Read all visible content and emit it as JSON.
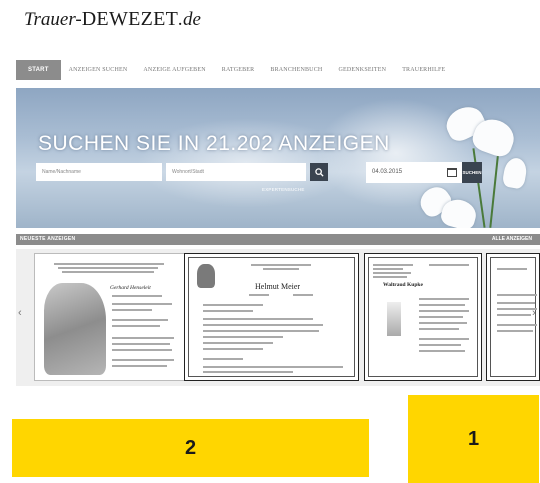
{
  "logo": {
    "part1": "Trauer-",
    "part2": "DEWEZET",
    "part3": ".de"
  },
  "nav": {
    "items": [
      {
        "label": "Start",
        "active": true
      },
      {
        "label": "Anzeigen suchen",
        "active": false
      },
      {
        "label": "Anzeige aufgeben",
        "active": false
      },
      {
        "label": "Ratgeber",
        "active": false
      },
      {
        "label": "Branchenbuch",
        "active": false
      },
      {
        "label": "Gedenkseiten",
        "active": false
      },
      {
        "label": "Trauerhilfe",
        "active": false
      }
    ]
  },
  "hero": {
    "title": "SUCHEN SIE IN 21.202 ANZEIGEN",
    "name_placeholder": "Name/Nachname",
    "city_placeholder": "Wohnort/Stadt",
    "expert_link": "Expertensuche",
    "date_value": "04.03.2015",
    "date_button": "Suchen"
  },
  "section": {
    "title": "Neueste Anzeigen",
    "link": "Alle Anzeigen"
  },
  "cards": [
    {
      "name": "Gerhard Henseleit"
    },
    {
      "name": "Helmut Meier"
    },
    {
      "name": "Waltraud Kupke"
    },
    {
      "name": ""
    }
  ],
  "carousel": {
    "prev_icon": "chevron-left-icon",
    "next_icon": "chevron-right-icon"
  },
  "highlights": {
    "box1": "1",
    "box2": "2"
  },
  "colors": {
    "highlight": "#ffd600",
    "nav_active": "#8c8c8c",
    "button": "#3a4450"
  }
}
